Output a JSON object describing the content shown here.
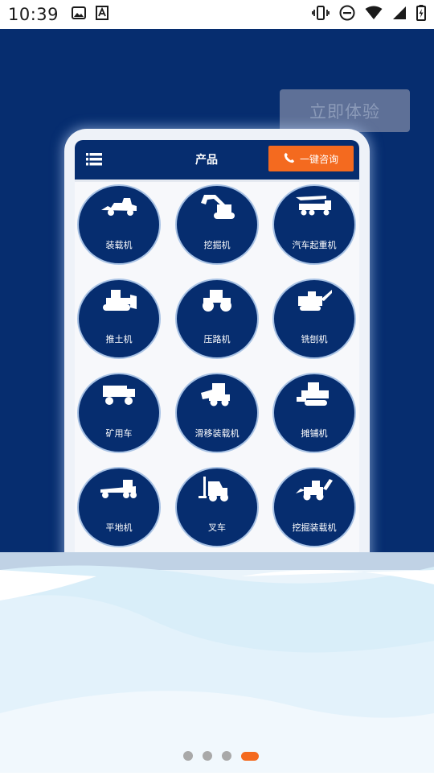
{
  "status_bar": {
    "time": "10:39",
    "icons": [
      "image-icon",
      "text-icon",
      "vibrate-icon",
      "do-not-disturb-icon",
      "wifi-icon",
      "battery-icon"
    ]
  },
  "hero": {
    "try_button_label": "立即体验"
  },
  "app": {
    "title": "产品",
    "consult_label": "一键咨询",
    "products": [
      {
        "label": "装载机",
        "icon": "loader-icon"
      },
      {
        "label": "挖掘机",
        "icon": "excavator-icon"
      },
      {
        "label": "汽车起重机",
        "icon": "truck-crane-icon"
      },
      {
        "label": "推土机",
        "icon": "bulldozer-icon"
      },
      {
        "label": "压路机",
        "icon": "road-roller-icon"
      },
      {
        "label": "铣刨机",
        "icon": "milling-machine-icon"
      },
      {
        "label": "矿用车",
        "icon": "mining-truck-icon"
      },
      {
        "label": "滑移装载机",
        "icon": "skid-steer-loader-icon"
      },
      {
        "label": "摊铺机",
        "icon": "paver-icon"
      },
      {
        "label": "平地机",
        "icon": "grader-icon"
      },
      {
        "label": "叉车",
        "icon": "forklift-icon"
      },
      {
        "label": "挖掘装载机",
        "icon": "backhoe-loader-icon"
      }
    ]
  },
  "pager": {
    "count": 4,
    "active_index": 3
  },
  "colors": {
    "navy": "#062d6f",
    "orange": "#f46a1f",
    "button_disabled": "#5e7097"
  }
}
